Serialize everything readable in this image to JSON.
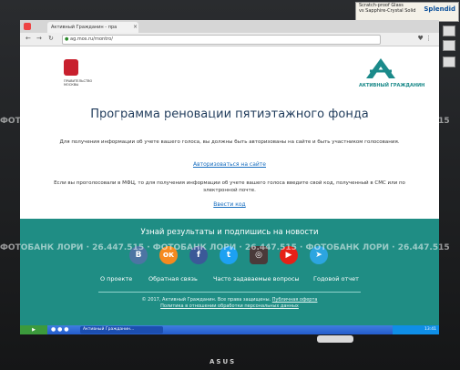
{
  "sticker": {
    "line1": "Scratch-proof Glass",
    "line2": "vs Sapphire-Crystal Solid",
    "brand": "Splendid"
  },
  "browser": {
    "tab_title": "Активный Гражданин - пра",
    "url": "ag.mos.ru/rnontro/"
  },
  "header": {
    "mos_caption": "ПРАВИТЕЛЬСТВО МОСКВЫ",
    "brand_caption": "АКТИВНЫЙ ГРАЖДАНИН"
  },
  "main": {
    "title": "Программа реновации пятиэтажного фонда",
    "para1": "Для получения информации об учете вашего голоса, вы должны быть авторизованы на сайте и быть участником голосования.",
    "auth_link": "Авторизоваться на сайте",
    "para2": "Если вы проголосовали в МФЦ, то для получения информации об учете вашего голоса введите свой код, полученный в СМС или по электронной почте.",
    "code_link": "Ввести код"
  },
  "footer": {
    "subscribe": "Узнай результаты и подпишись на новости",
    "links": [
      "О проекте",
      "Обратная связь",
      "Часто задаваемые вопросы",
      "Годовой отчет"
    ],
    "copyright": "© 2017, Активный Гражданин. Все права защищены.",
    "offer": "Публичная оферта",
    "policy": "Политика в отношении обработки персональных данных"
  },
  "social_icons": [
    "vk-icon",
    "odnoklassniki-icon",
    "facebook-icon",
    "twitter-icon",
    "instagram-icon",
    "youtube-icon",
    "telegram-icon"
  ],
  "taskbar": {
    "item": "Активный Гражданин...",
    "time": "13:41"
  },
  "watermark": "ФОТОБАНК ЛОРИ · 26.447.515 · ФОТОБАНК ЛОРИ · 26.447.515 · ФОТОБАНК ЛОРИ · 26.447.515",
  "bezel": {
    "brand": "ASUS"
  },
  "colors": {
    "footer": "#1f8d84",
    "title": "#1e3a5a",
    "link": "#1a6fc0",
    "accent": "#1b8a8a"
  }
}
